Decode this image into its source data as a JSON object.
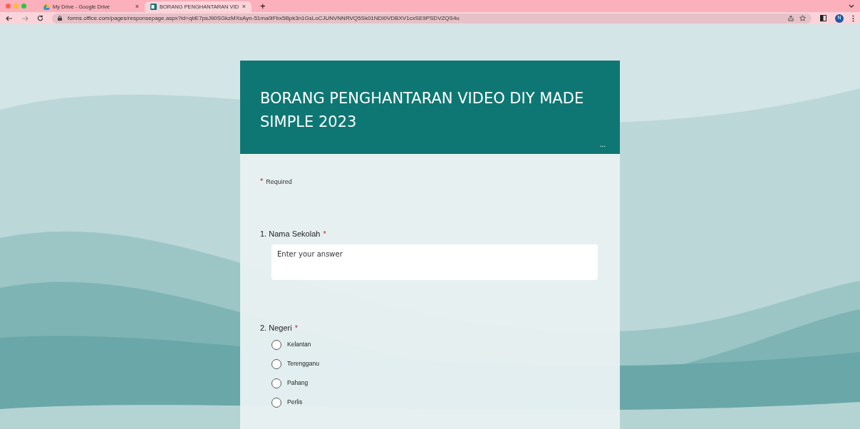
{
  "browser": {
    "tabs": [
      {
        "title": "My Drive - Google Drive",
        "close": "×",
        "selected": false,
        "kind": "drive"
      },
      {
        "title": "BORANG PENGHANTARAN VID",
        "close": "×",
        "selected": true,
        "kind": "forms"
      }
    ],
    "new_tab": "+",
    "url": "forms.office.com/pages/responsepage.aspx?id=qbE7psJIi0SGkzMXsAyn-51ma0iFbx5Bpk3n1GsLoCJUNVNNRVQ5Sk01NDI0VDBXV1cxSE9PSDVZQS4u",
    "profile": "N"
  },
  "form": {
    "title": "BORANG PENGHANTARAN VIDEO DIY MADE SIMPLE 2023",
    "more": "...",
    "required_mark": "*",
    "required_note": "Required",
    "questions": [
      {
        "kind": "text",
        "number": "1.",
        "label": "Nama Sekolah",
        "required": true,
        "placeholder": "Enter your answer"
      },
      {
        "kind": "choice",
        "number": "2.",
        "label": "Negeri",
        "required": true,
        "options": [
          {
            "label": "Kelantan",
            "selected": false
          },
          {
            "label": "Terengganu",
            "selected": false
          },
          {
            "label": "Pahang",
            "selected": false
          },
          {
            "label": "Perlis",
            "selected": false
          }
        ]
      }
    ]
  }
}
